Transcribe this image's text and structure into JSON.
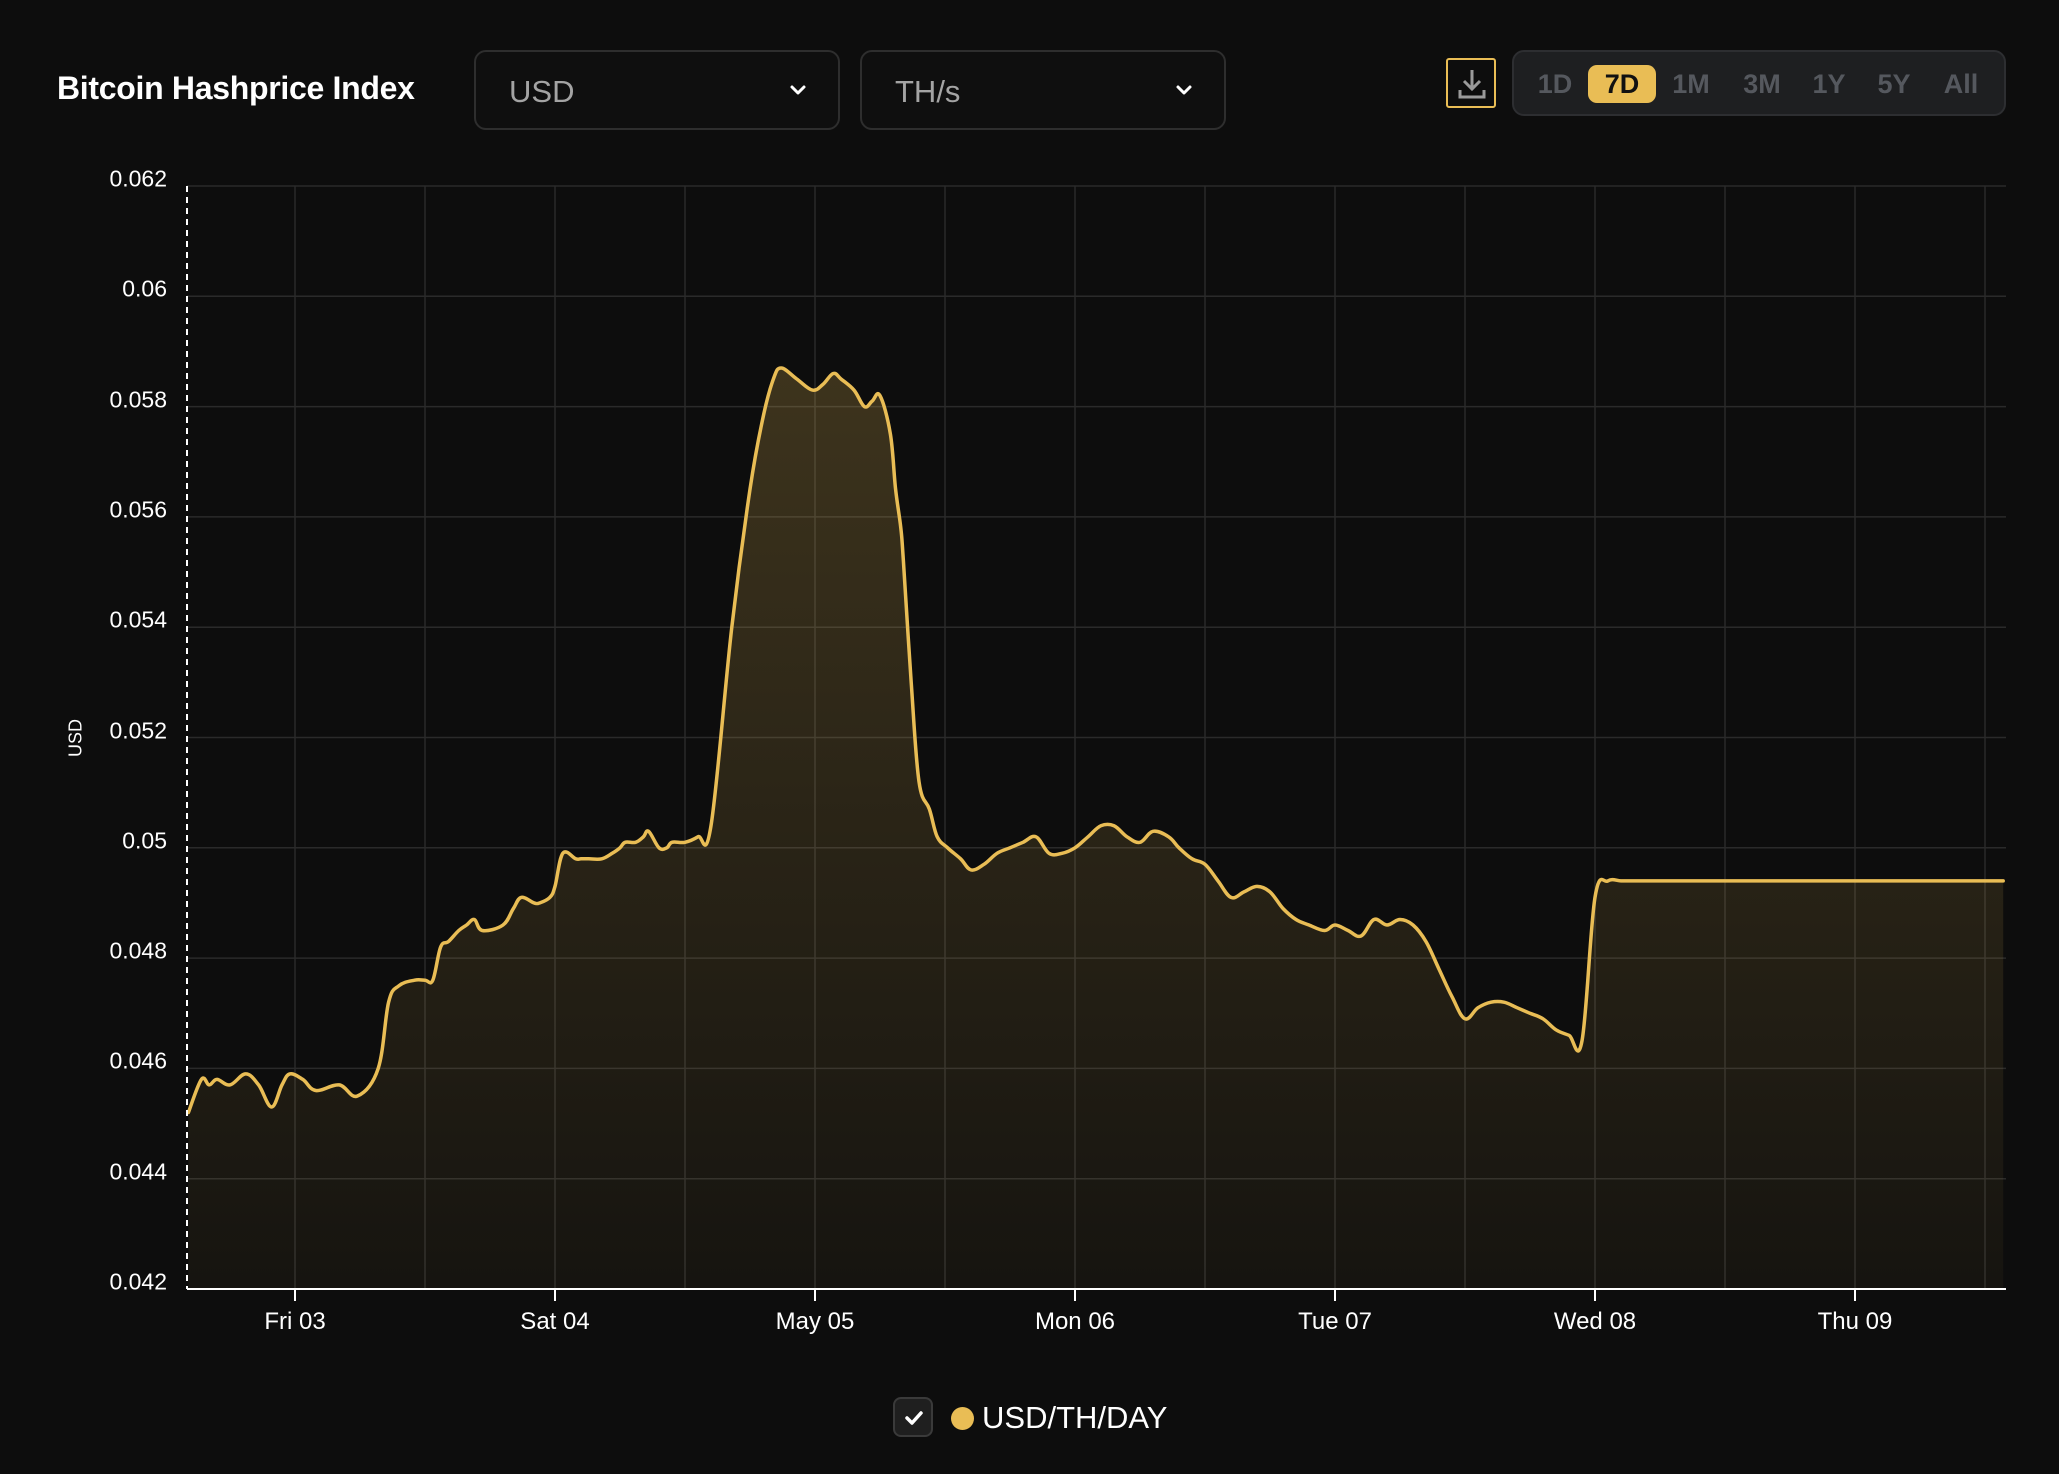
{
  "header": {
    "title": "Bitcoin Hashprice Index",
    "currency": {
      "selected": "USD"
    },
    "unit": {
      "selected": "TH/s"
    },
    "ranges": [
      "1D",
      "7D",
      "1M",
      "3M",
      "1Y",
      "5Y",
      "All"
    ],
    "active_range": "7D"
  },
  "colors": {
    "accent": "#e9bd55",
    "background": "#0d0d0d",
    "grid": "#2a2a2a"
  },
  "icons": {
    "download": "download-icon",
    "chevron": "chevron-down-icon",
    "check": "check-icon"
  },
  "legend": {
    "label": "USD/TH/DAY",
    "checked": true
  },
  "chart_data": {
    "type": "area",
    "title": "",
    "xlabel": "",
    "ylabel": "USD",
    "x_ticks": [
      "Fri 03",
      "Sat 04",
      "May 05",
      "Mon 06",
      "Tue 07",
      "Wed 08",
      "Thu 09"
    ],
    "y_ticks": [
      "0.042",
      "0.044",
      "0.046",
      "0.048",
      "0.05",
      "0.052",
      "0.054",
      "0.056",
      "0.058",
      "0.06",
      "0.062"
    ],
    "ylim": [
      0.042,
      0.062
    ],
    "xlim_days": [
      -0.41,
      6.57
    ],
    "grid": true,
    "legend_position": "bottom-center",
    "series": [
      {
        "name": "USD/TH/DAY",
        "color": "#e9bd55",
        "x": [
          -0.41,
          -0.36,
          -0.33,
          -0.3,
          -0.25,
          -0.19,
          -0.14,
          -0.09,
          -0.05,
          -0.02,
          0.03,
          0.08,
          0.17,
          0.24,
          0.32,
          0.36,
          0.4,
          0.46,
          0.5,
          0.53,
          0.56,
          0.59,
          0.63,
          0.66,
          0.69,
          0.72,
          0.8,
          0.84,
          0.87,
          0.92,
          0.94,
          0.98,
          1.0,
          1.03,
          1.08,
          1.1,
          1.13,
          1.18,
          1.22,
          1.25,
          1.27,
          1.31,
          1.34,
          1.36,
          1.4,
          1.43,
          1.45,
          1.5,
          1.55,
          1.6,
          1.68,
          1.75,
          1.8,
          1.84,
          1.87,
          1.93,
          1.99,
          2.03,
          2.07,
          2.1,
          2.15,
          2.19,
          2.22,
          2.25,
          2.29,
          2.31,
          2.33,
          2.34,
          2.37,
          2.4,
          2.44,
          2.47,
          2.51,
          2.56,
          2.6,
          2.65,
          2.7,
          2.75,
          2.8,
          2.85,
          2.9,
          2.95,
          3.0,
          3.05,
          3.1,
          3.15,
          3.2,
          3.25,
          3.3,
          3.36,
          3.4,
          3.45,
          3.5,
          3.55,
          3.6,
          3.65,
          3.7,
          3.75,
          3.8,
          3.85,
          3.9,
          3.96,
          4.0,
          4.05,
          4.1,
          4.15,
          4.2,
          4.25,
          4.3,
          4.35,
          4.4,
          4.45,
          4.5,
          4.55,
          4.6,
          4.65,
          4.7,
          4.75,
          4.8,
          4.85,
          4.9,
          4.95,
          5.0,
          5.05,
          5.1,
          5.15,
          5.2,
          5.25,
          5.3,
          5.35,
          5.4,
          5.45,
          5.5,
          5.55,
          5.6,
          5.65,
          5.7,
          5.75,
          5.8,
          5.85,
          5.9,
          5.95,
          6.0,
          6.05,
          6.1,
          6.15,
          6.2,
          6.25,
          6.3,
          6.35,
          6.4,
          6.45,
          6.48,
          6.5,
          6.53,
          6.57
        ],
        "y": [
          0.0452,
          0.0458,
          0.0457,
          0.0458,
          0.0457,
          0.0459,
          0.0457,
          0.0453,
          0.0457,
          0.0459,
          0.0458,
          0.0456,
          0.0457,
          0.0455,
          0.046,
          0.0472,
          0.0475,
          0.0476,
          0.0476,
          0.0476,
          0.0482,
          0.0483,
          0.0485,
          0.0486,
          0.0487,
          0.0485,
          0.0486,
          0.0489,
          0.0491,
          0.049,
          0.049,
          0.0491,
          0.0493,
          0.0499,
          0.0498,
          0.0498,
          0.0498,
          0.0498,
          0.0499,
          0.05,
          0.0501,
          0.0501,
          0.0502,
          0.0503,
          0.05,
          0.05,
          0.0501,
          0.0501,
          0.0502,
          0.0504,
          0.054,
          0.0565,
          0.0578,
          0.0585,
          0.0587,
          0.0585,
          0.0583,
          0.0584,
          0.0586,
          0.0585,
          0.0583,
          0.058,
          0.0581,
          0.0582,
          0.0575,
          0.0565,
          0.0558,
          0.0552,
          0.053,
          0.0512,
          0.0507,
          0.0502,
          0.05,
          0.0498,
          0.0496,
          0.0497,
          0.0499,
          0.05,
          0.0501,
          0.0502,
          0.0499,
          0.0499,
          0.05,
          0.0502,
          0.0504,
          0.0504,
          0.0502,
          0.0501,
          0.0503,
          0.0502,
          0.05,
          0.0498,
          0.0497,
          0.0494,
          0.0491,
          0.0492,
          0.0493,
          0.0492,
          0.0489,
          0.0487,
          0.0486,
          0.0485,
          0.0486,
          0.0485,
          0.0484,
          0.0487,
          0.0486,
          0.0487,
          0.0486,
          0.0483,
          0.0478,
          0.0473,
          0.0469,
          0.0471,
          0.0472,
          0.0472,
          0.0471,
          0.047,
          0.0469,
          0.0467,
          0.0466,
          0.0465,
          0.0491,
          0.0494,
          0.0494,
          0.0494,
          0.0494,
          0.0494,
          0.0494,
          0.0494,
          0.0494,
          0.0494,
          0.0494,
          0.0494,
          0.0494,
          0.0494,
          0.0494,
          0.0494,
          0.0494,
          0.0494,
          0.0494,
          0.0494,
          0.0494,
          0.0494,
          0.0494,
          0.0494,
          0.0494,
          0.0494,
          0.0494,
          0.0494,
          0.0494,
          0.0494,
          0.0494,
          0.0494,
          0.0494,
          0.0494
        ]
      }
    ]
  }
}
